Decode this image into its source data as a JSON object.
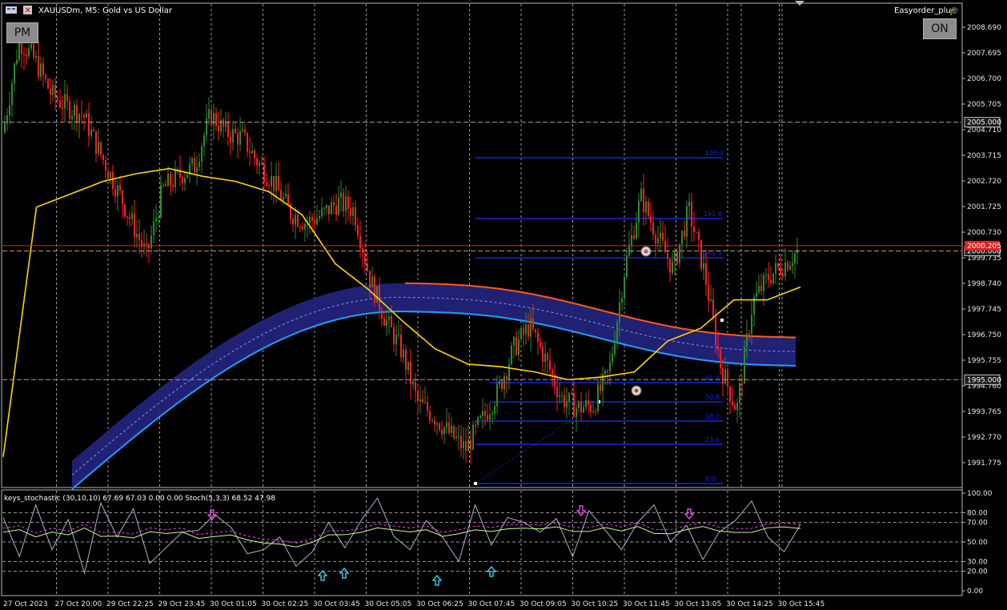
{
  "window": {
    "title": "XAUUSDm, M5:  Gold vs US Dollar",
    "expert_name": "Easyorder_plus"
  },
  "buttons": {
    "pm_label": "PM",
    "on_label": "ON"
  },
  "colors": {
    "background": "#000000",
    "bull_candle": "#2e8b2e",
    "bear_candle": "#ff2020",
    "ma_line": "#ffd700",
    "band_fill": "#23237a",
    "band_upper": "#ff5a1e",
    "band_lower": "#1ea0ff",
    "fib_color": "#1428d8",
    "grid": "#9a9a9a",
    "stoch_main": "#a8b4c8",
    "stoch_signal": "#c8ff8c",
    "stoch_dashed": "#ff3cff"
  },
  "price_axis": {
    "ticks": [
      "2008.690",
      "2007.695",
      "2006.700",
      "2005.705",
      "2004.710",
      "2003.715",
      "2002.720",
      "2001.725",
      "2000.730",
      "1999.735",
      "1998.740",
      "1997.745",
      "1996.750",
      "1995.755",
      "1994.760",
      "1993.765",
      "1992.770",
      "1991.775"
    ],
    "boxed_labels": [
      "2005.000",
      "2000.000",
      "1995.000"
    ],
    "price_line": "2000.205"
  },
  "time_axis": {
    "labels": [
      "27 Oct 2023",
      "27 Oct 20:00",
      "29 Oct 22:25",
      "29 Oct 23:45",
      "30 Oct 01:05",
      "30 Oct 02:25",
      "30 Oct 03:45",
      "30 Oct 05:05",
      "30 Oct 06:25",
      "30 Oct 07:45",
      "30 Oct 09:05",
      "30 Oct 10:25",
      "30 Oct 11:45",
      "30 Oct 13:05",
      "30 Oct 14:25",
      "30 Oct 15:45"
    ]
  },
  "fibonacci": {
    "levels": [
      "100.0",
      "61.8",
      "50.0",
      "38.2",
      "23.6",
      "0.0"
    ],
    "extra_levels": [
      "161.8",
      "261.8"
    ]
  },
  "indicator": {
    "label": "keys_stochastic (30,10,10) 67.69 67.03 0.00 0.00 Stoch(5,3,3) 68.52 47.98",
    "ticks": [
      "100.00",
      "80.00",
      "70.00",
      "50.00",
      "30.00",
      "20.00",
      "0.00"
    ]
  },
  "chart_data": {
    "type": "line",
    "symbol": "XAUUSDm",
    "timeframe": "M5",
    "ylim": [
      1991.3,
      2009.2
    ],
    "grid": true,
    "series_notes": "candlestick price series with moving average, envelope band, fibonacci retracement and stochastic sub-window",
    "price_path": [
      2004.6,
      2008.2,
      2007.4,
      2006.1,
      2005.6,
      2005.3,
      2003.9,
      2002.6,
      2001.2,
      1999.8,
      2002.4,
      2002.9,
      2003.3,
      2005.3,
      2004.6,
      2004.4,
      2003.4,
      2002.6,
      2001.5,
      2001.1,
      2001.4,
      2001.9,
      2001.6,
      1998.9,
      1997.3,
      1996.1,
      1994.1,
      1993.6,
      1992.9,
      1992.3,
      1993.4,
      1994.5,
      1996.2,
      1997.1,
      1995.8,
      1994.3,
      1993.9,
      1994.0,
      1995.3,
      1999.4,
      2002.1,
      2000.6,
      1999.3,
      2001.6,
      1999.1,
      1995.5,
      1993.8,
      1998.0,
      1999.0,
      1999.5,
      2000.1
    ],
    "ma_path": [
      1992.0,
      2001.7,
      2002.2,
      2002.7,
      2003.0,
      2003.2,
      2002.9,
      2002.7,
      2002.3,
      2001.4,
      1999.5,
      1998.5,
      1997.3,
      1996.2,
      1995.6,
      1995.5,
      1995.3,
      1995.0,
      1995.1,
      1995.3,
      1996.5,
      1997.0,
      1998.1,
      1998.1,
      1998.6
    ],
    "stoch_levels": [
      100,
      80,
      70,
      50,
      30,
      20,
      0
    ],
    "stoch_values": [
      75,
      35,
      88,
      42,
      73,
      18,
      90,
      55,
      84,
      28,
      44,
      60,
      62,
      78,
      65,
      38,
      42,
      55,
      25,
      40,
      70,
      44,
      72,
      95,
      56,
      42,
      72,
      55,
      30,
      88,
      47,
      75,
      70,
      60,
      74,
      35,
      82,
      62,
      42,
      70,
      88,
      50,
      67,
      32,
      60,
      72,
      92,
      55,
      40,
      68
    ]
  }
}
